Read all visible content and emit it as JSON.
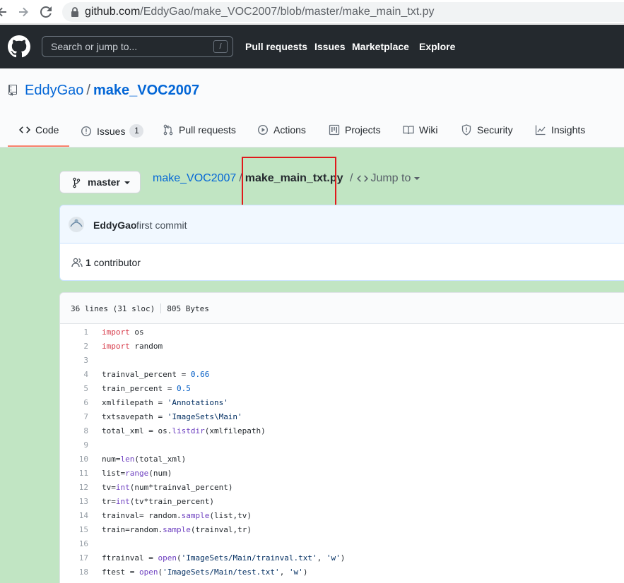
{
  "browser": {
    "url_host": "github.com",
    "url_path": "/EddyGao/make_VOC2007/blob/master/make_main_txt.py"
  },
  "header": {
    "search_placeholder": "Search or jump to...",
    "search_shortcut": "/",
    "nav": [
      "Pull requests",
      "Issues",
      "Marketplace",
      "Explore"
    ]
  },
  "repo": {
    "owner": "EddyGao",
    "separator": "/",
    "name": "make_VOC2007",
    "tabs": [
      {
        "label": "Code",
        "icon": "code-icon"
      },
      {
        "label": "Issues",
        "icon": "issue-icon",
        "count": "1"
      },
      {
        "label": "Pull requests",
        "icon": "pull-request-icon"
      },
      {
        "label": "Actions",
        "icon": "play-icon"
      },
      {
        "label": "Projects",
        "icon": "project-icon"
      },
      {
        "label": "Wiki",
        "icon": "book-icon"
      },
      {
        "label": "Security",
        "icon": "shield-icon"
      },
      {
        "label": "Insights",
        "icon": "graph-icon"
      }
    ]
  },
  "file_nav": {
    "branch": "master",
    "crumb_repo": "make_VOC2007",
    "crumb_sep": "/",
    "crumb_file": "make_main_txt.py",
    "jump_sep": "/",
    "jump_label": "Jump to"
  },
  "commit": {
    "author": "EddyGao",
    "message": "first commit",
    "contributors_count": "1",
    "contributors_label": "contributor"
  },
  "file": {
    "lines_info": "36 lines (31 sloc)",
    "size": "805 Bytes",
    "code_lines": [
      {
        "n": "1",
        "text": "import os"
      },
      {
        "n": "2",
        "text": "import random"
      },
      {
        "n": "3",
        "text": ""
      },
      {
        "n": "4",
        "text": "trainval_percent = 0.66"
      },
      {
        "n": "5",
        "text": "train_percent = 0.5"
      },
      {
        "n": "6",
        "text": "xmlfilepath = 'Annotations'"
      },
      {
        "n": "7",
        "text": "txtsavepath = 'ImageSets\\Main'"
      },
      {
        "n": "8",
        "text": "total_xml = os.listdir(xmlfilepath)"
      },
      {
        "n": "9",
        "text": ""
      },
      {
        "n": "10",
        "text": "num=len(total_xml)"
      },
      {
        "n": "11",
        "text": "list=range(num)"
      },
      {
        "n": "12",
        "text": "tv=int(num*trainval_percent)"
      },
      {
        "n": "13",
        "text": "tr=int(tv*train_percent)"
      },
      {
        "n": "14",
        "text": "trainval= random.sample(list,tv)"
      },
      {
        "n": "15",
        "text": "train=random.sample(trainval,tr)"
      },
      {
        "n": "16",
        "text": ""
      },
      {
        "n": "17",
        "text": "ftrainval = open('ImageSets/Main/trainval.txt', 'w')"
      },
      {
        "n": "18",
        "text": "ftest = open('ImageSets/Main/test.txt', 'w')"
      }
    ]
  },
  "colors": {
    "highlight_bg": "#c1e5c3",
    "annotation_box": "#e0191c",
    "link": "#0366d6",
    "header_bg": "#24292e",
    "active_tab_underline": "#f9826c"
  }
}
